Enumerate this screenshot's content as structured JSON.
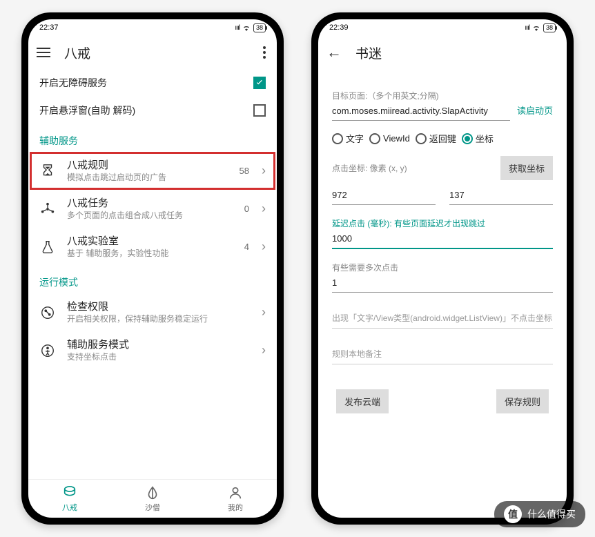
{
  "left": {
    "status": {
      "time": "22:37",
      "battery": "38"
    },
    "title": "八戒",
    "toggles": {
      "accessibility": {
        "label": "开启无障碍服务",
        "checked": true
      },
      "floating": {
        "label": "开启悬浮窗(自助 解码)",
        "checked": false
      }
    },
    "sections": {
      "assist": {
        "header": "辅助服务",
        "items": [
          {
            "title": "八戒规则",
            "sub": "模拟点击跳过启动页的广告",
            "count": "58"
          },
          {
            "title": "八戒任务",
            "sub": "多个页面的点击组合成八戒任务",
            "count": "0"
          },
          {
            "title": "八戒实验室",
            "sub": "基于 辅助服务，实验性功能",
            "count": "4"
          }
        ]
      },
      "runmode": {
        "header": "运行模式",
        "items": [
          {
            "title": "检查权限",
            "sub": "开启相关权限，保持辅助服务稳定运行"
          },
          {
            "title": "辅助服务模式",
            "sub": "支持坐标点击"
          }
        ]
      }
    },
    "nav": {
      "bajie": "八戒",
      "shaseng": "沙僧",
      "mine": "我的"
    }
  },
  "right": {
    "status": {
      "time": "22:39",
      "battery": "38"
    },
    "title": "书迷",
    "target_label": "目标页面:（多个用英文;分隔)",
    "target_value": "com.moses.miiread.activity.SlapActivity",
    "read_launch": "读启动页",
    "radios": {
      "text": "文字",
      "viewid": "ViewId",
      "back": "返回键",
      "coord": "坐标",
      "selected": "coord"
    },
    "coord_label": "点击坐标: 像素 (x, y)",
    "get_coord_btn": "获取坐标",
    "coord_x": "972",
    "coord_y": "137",
    "delay_label": "延迟点击 (毫秒): 有些页面延迟才出现跳过",
    "delay_value": "1000",
    "multi_label": "有些需要多次点击",
    "multi_value": "1",
    "placeholder_excl": "出现「文字/View类型(android.widget.ListView)」不点击坐标",
    "placeholder_note": "规则本地备注",
    "btn_publish": "发布云端",
    "btn_save": "保存规则"
  },
  "watermark": {
    "icon": "值",
    "text": "什么值得买"
  }
}
